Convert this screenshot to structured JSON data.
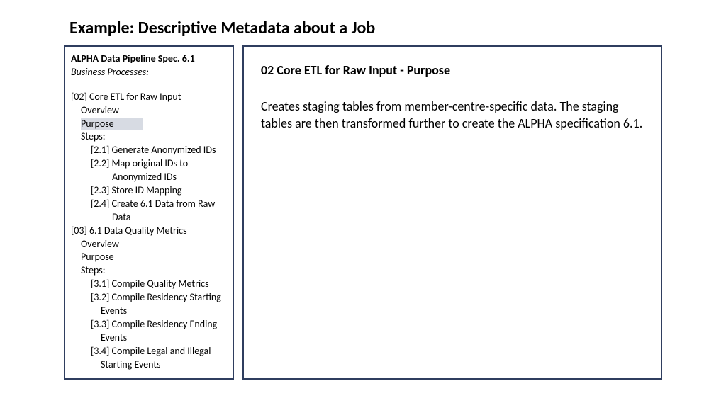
{
  "header": {
    "title": "Example: Descriptive Metadata about a Job"
  },
  "sidebar": {
    "title": "ALPHA Data Pipeline Spec. 6.1",
    "subtitle": "Business Processes:",
    "section02": {
      "heading": "[02] Core ETL for Raw Input",
      "overview": "Overview",
      "purpose": "Purpose",
      "stepsLabel": "Steps:",
      "step1": "[2.1] Generate Anonymized IDs",
      "step2a": "[2.2] Map original IDs to",
      "step2b": "Anonymized IDs",
      "step3": "[2.3] Store ID Mapping",
      "step4a": "[2.4] Create 6.1 Data from Raw",
      "step4b": "Data"
    },
    "section03": {
      "heading": "[03] 6.1 Data Quality Metrics",
      "overview": "Overview",
      "purpose": "Purpose",
      "stepsLabel": "Steps:",
      "step1": "[3.1] Compile Quality Metrics",
      "step2a": "[3.2] Compile Residency Starting",
      "step2b": "Events",
      "step3a": "[3.3] Compile Residency Ending",
      "step3b": "Events",
      "step4a": "[3.4] Compile Legal and Illegal",
      "step4b": "Starting Events"
    }
  },
  "content": {
    "title": "02 Core ETL for Raw Input - Purpose",
    "body": "Creates staging tables from member-centre-specific data. The staging tables are then transformed further to create the ALPHA specification 6.1."
  }
}
